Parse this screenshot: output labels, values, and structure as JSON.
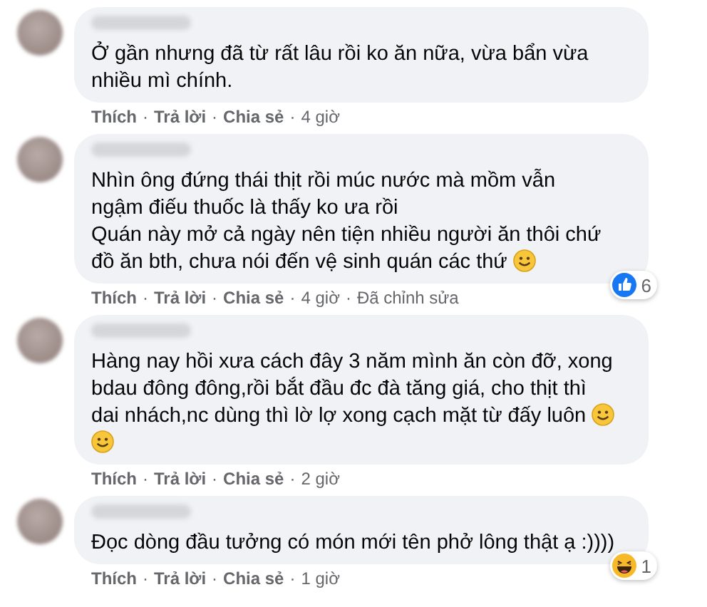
{
  "separator": "·",
  "comments": [
    {
      "lines": [
        {
          "text": "Ở gần nhưng đã từ rất lâu rồi ko ăn nữa, vừa bẩn vừa"
        },
        {
          "text": "nhiều mì chính."
        }
      ],
      "actions": [
        "Thích",
        "Trả lời",
        "Chia sẻ"
      ],
      "time": "4 giờ"
    },
    {
      "lines": [
        {
          "text": "Nhìn ông đứng thái thịt rồi múc nước mà mồm vẫn"
        },
        {
          "text": "ngậm điếu thuốc là thấy ko ưa rồi"
        },
        {
          "text": "Quán này mở cả ngày nên tiện nhiều người ăn thôi chứ"
        },
        {
          "text": "đồ ăn bth, chưa nói đến vệ sinh quán các thứ",
          "emoji": {
            "kind": "smile"
          }
        }
      ],
      "actions": [
        "Thích",
        "Trả lời",
        "Chia sẻ"
      ],
      "time": "4 giờ",
      "edited": "Đã chỉnh sửa",
      "reaction": {
        "kind": "like",
        "count": "6"
      }
    },
    {
      "lines": [
        {
          "text": "Hàng nay hồi xưa cách đây 3 năm mình ăn còn đỡ, xong"
        },
        {
          "text": "bdau đông đông,rồi bắt đầu đc đà tăng giá, cho thịt thì"
        },
        {
          "text": "dai nhách,nc dùng thì lờ lợ xong cạch mặt từ đấy luôn",
          "emoji": {
            "kind": "smile"
          }
        },
        {
          "emoji": {
            "kind": "smile"
          }
        }
      ],
      "actions": [
        "Thích",
        "Trả lời",
        "Chia sẻ"
      ],
      "time": "2 giờ"
    },
    {
      "lines": [
        {
          "text": "Đọc dòng đầu tưởng có món mới tên phở lông thật ạ :))))"
        }
      ],
      "actions": [
        "Thích",
        "Trả lời",
        "Chia sẻ"
      ],
      "time": "1 giờ",
      "reaction": {
        "kind": "haha",
        "count": "1"
      }
    }
  ]
}
